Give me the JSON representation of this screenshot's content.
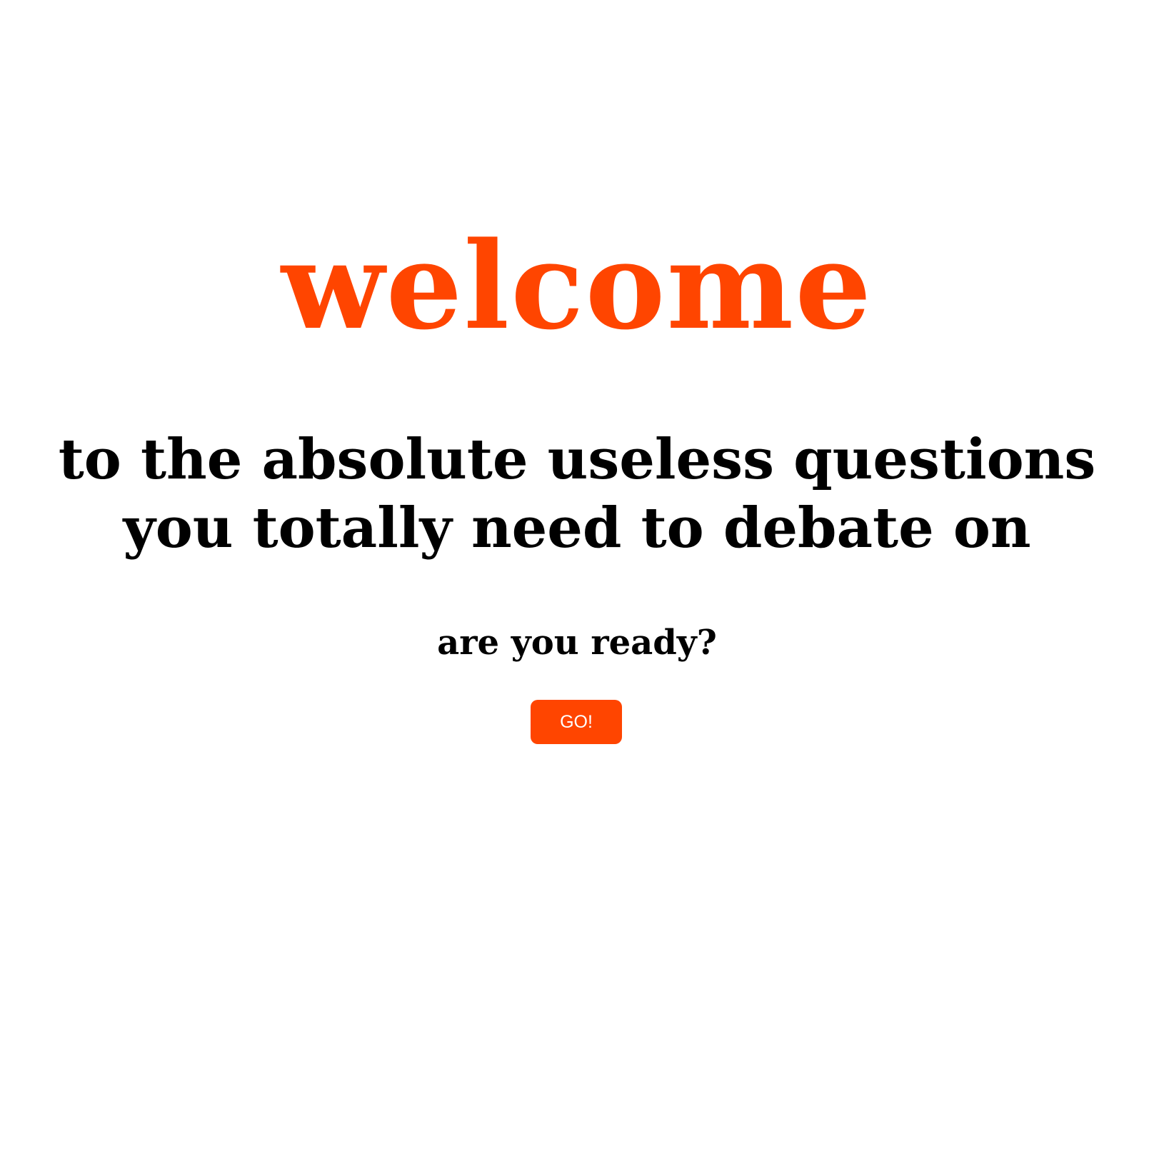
{
  "hero": {
    "title": "welcome",
    "subtitle_line1": "to the absolute useless questions",
    "subtitle_line2": "you totally need to debate on",
    "prompt": "are you ready?"
  },
  "actions": {
    "go_label": "GO!"
  },
  "colors": {
    "accent": "#ff4500",
    "text": "#000000",
    "background": "#ffffff",
    "button_text": "#ffffff"
  }
}
